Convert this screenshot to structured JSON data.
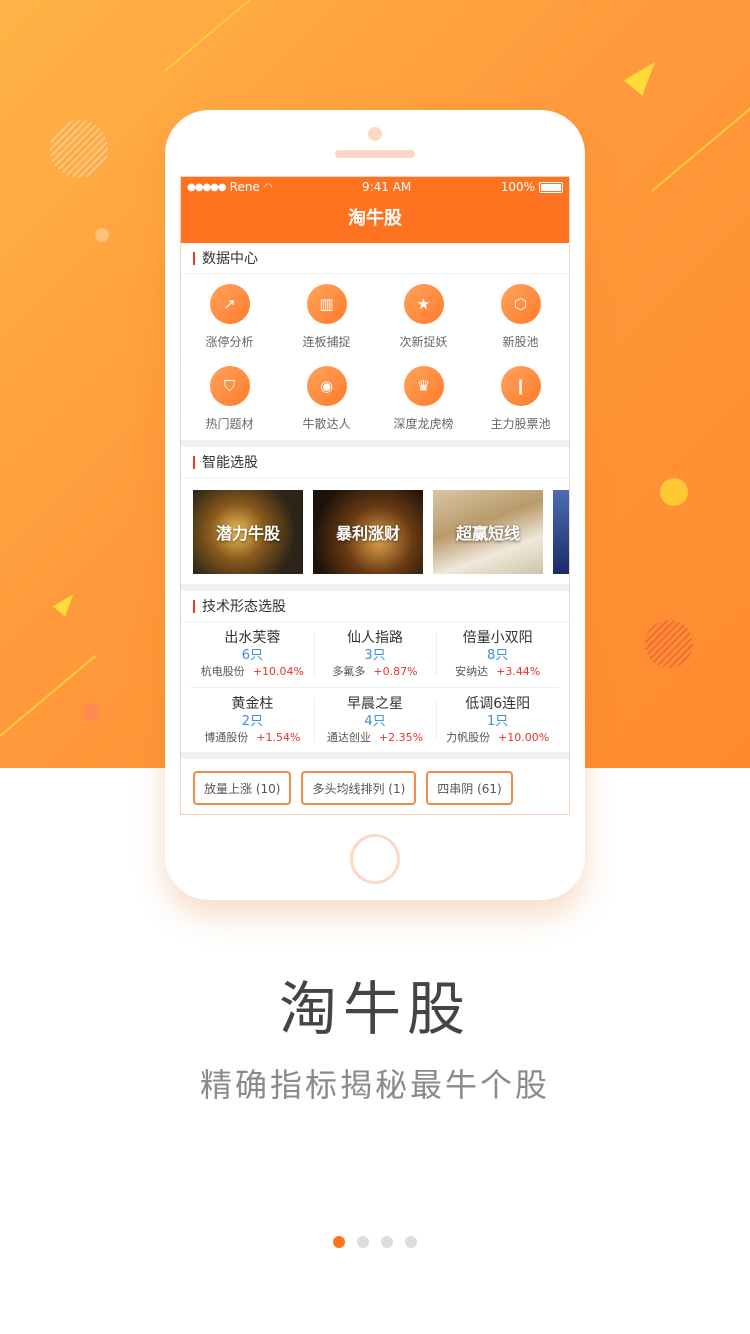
{
  "status_bar": {
    "carrier": "Rene",
    "time": "9:41 AM",
    "battery": "100%"
  },
  "app": {
    "title": "淘牛股"
  },
  "data_center": {
    "title": "数据中心",
    "items": [
      {
        "label": "涨停分析",
        "icon": "trend-up-icon"
      },
      {
        "label": "连板捕捉",
        "icon": "monitor-chart-icon"
      },
      {
        "label": "次新捉妖",
        "icon": "medal-icon"
      },
      {
        "label": "新股池",
        "icon": "ipo-icon"
      },
      {
        "label": "热门题材",
        "icon": "shield-trend-icon"
      },
      {
        "label": "牛散达人",
        "icon": "target-icon"
      },
      {
        "label": "深度龙虎榜",
        "icon": "trophy-icon"
      },
      {
        "label": "主力股票池",
        "icon": "candlestick-icon"
      }
    ]
  },
  "smart_picks": {
    "title": "智能选股",
    "cards": [
      "潜力牛股",
      "暴利涨财",
      "超赢短线"
    ]
  },
  "tech_patterns": {
    "title": "技术形态选股",
    "rows": [
      [
        {
          "name": "出水芙蓉",
          "count": "6只",
          "stock": "杭电股份",
          "change": "+10.04%"
        },
        {
          "name": "仙人指路",
          "count": "3只",
          "stock": "多氟多",
          "change": "+0.87%"
        },
        {
          "name": "倍量小双阳",
          "count": "8只",
          "stock": "安纳达",
          "change": "+3.44%"
        }
      ],
      [
        {
          "name": "黄金柱",
          "count": "2只",
          "stock": "博通股份",
          "change": "+1.54%"
        },
        {
          "name": "早晨之星",
          "count": "4只",
          "stock": "通达创业",
          "change": "+2.35%"
        },
        {
          "name": "低调6连阳",
          "count": "1只",
          "stock": "力帆股份",
          "change": "+10.00%"
        }
      ]
    ]
  },
  "tags": [
    "放量上涨 (10)",
    "多头均线排列 (1)",
    "四串阴 (61)"
  ],
  "promo": {
    "title": "淘牛股",
    "subtitle": "精确指标揭秘最牛个股"
  },
  "pager": {
    "pages": 4,
    "active": 0
  },
  "colors": {
    "accent": "#ff7320",
    "up": "#e8352a",
    "count": "#3d8ee6"
  }
}
